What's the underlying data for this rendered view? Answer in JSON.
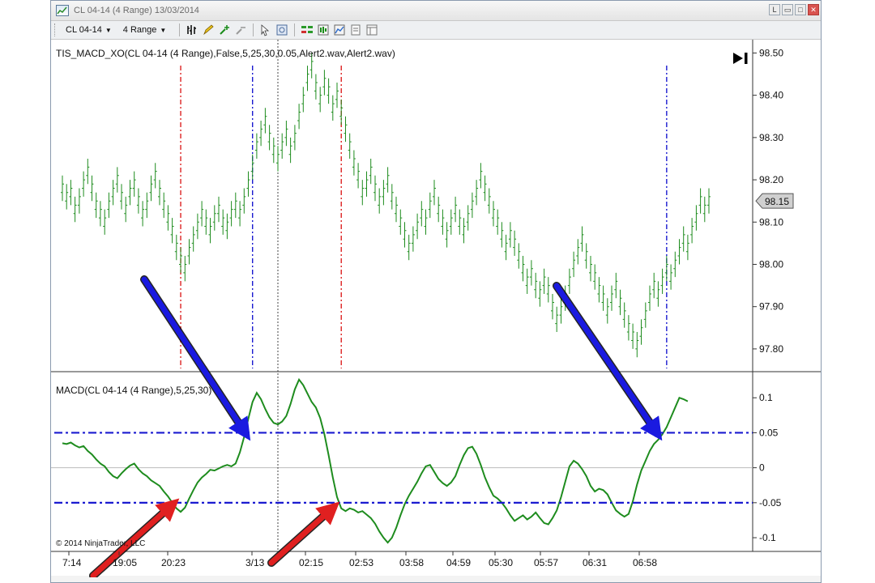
{
  "window": {
    "title": "CL 04-14 (4 Range)  13/03/2014",
    "controls": [
      "L",
      "▭",
      "□",
      "✕"
    ]
  },
  "toolbar": {
    "instrument": "CL 04-14",
    "interval": "4 Range"
  },
  "price_panel": {
    "indicator_label": "TIS_MACD_XO(CL 04-14 (4 Range),False,5,25,30,0.05,Alert2.wav,Alert2.wav)",
    "last_price": "98.15",
    "ticks": [
      "98.50",
      "98.40",
      "98.30",
      "98.20",
      "98.10",
      "98.00",
      "97.90",
      "97.80"
    ]
  },
  "macd_panel": {
    "indicator_label": "MACD(CL 04-14 (4 Range),5,25,30)",
    "ticks": [
      "0.1",
      "0.05",
      "0",
      "-0.05",
      "-0.1"
    ],
    "copyright": "© 2014 NinjaTrader, LLC"
  },
  "time_axis": {
    "ticks": [
      "7:14",
      "19:05",
      "20:23",
      "3/13",
      "02:15",
      "02:53",
      "03:58",
      "04:59",
      "05:30",
      "05:57",
      "06:31",
      "06:58"
    ]
  },
  "chart_data": {
    "type": "line",
    "price_series": {
      "ylim": [
        97.75,
        98.52
      ],
      "values": [
        98.18,
        98.16,
        98.17,
        98.13,
        98.15,
        98.19,
        98.22,
        98.18,
        98.14,
        98.12,
        98.1,
        98.14,
        98.17,
        98.2,
        98.16,
        98.13,
        98.17,
        98.19,
        98.15,
        98.12,
        98.14,
        98.18,
        98.21,
        98.17,
        98.14,
        98.11,
        98.08,
        98.04,
        98.01,
        97.99,
        98.03,
        98.06,
        98.09,
        98.12,
        98.1,
        98.08,
        98.11,
        98.13,
        98.1,
        98.09,
        98.12,
        98.14,
        98.12,
        98.15,
        98.19,
        98.23,
        98.28,
        98.31,
        98.34,
        98.3,
        98.27,
        98.25,
        98.28,
        98.31,
        98.27,
        98.3,
        98.35,
        98.39,
        98.44,
        98.47,
        98.42,
        98.39,
        98.43,
        98.41,
        98.37,
        98.4,
        98.36,
        98.32,
        98.28,
        98.24,
        98.21,
        98.17,
        98.19,
        98.22,
        98.18,
        98.15,
        98.17,
        98.2,
        98.16,
        98.13,
        98.1,
        98.07,
        98.04,
        98.06,
        98.09,
        98.12,
        98.1,
        98.14,
        98.17,
        98.13,
        98.1,
        98.07,
        98.1,
        98.13,
        98.1,
        98.08,
        98.11,
        98.14,
        98.17,
        98.21,
        98.18,
        98.15,
        98.12,
        98.1,
        98.07,
        98.04,
        98.07,
        98.05,
        98.02,
        97.99,
        97.96,
        97.98,
        97.95,
        97.93,
        97.96,
        97.94,
        97.9,
        97.87,
        97.89,
        97.92,
        97.96,
        98.0,
        98.03,
        98.06,
        98.02,
        97.99,
        97.97,
        97.94,
        97.92,
        97.89,
        97.92,
        97.95,
        97.91,
        97.88,
        97.85,
        97.83,
        97.81,
        97.84,
        97.88,
        97.92,
        97.95,
        97.93,
        97.96,
        97.99,
        97.97,
        98.0,
        98.03,
        98.06,
        98.04,
        98.08,
        98.11,
        98.15,
        98.13,
        98.15
      ]
    },
    "macd_series": {
      "ylim": [
        -0.115,
        0.135
      ],
      "values": [
        0.035,
        0.034,
        0.036,
        0.032,
        0.029,
        0.031,
        0.024,
        0.019,
        0.012,
        0.006,
        0.002,
        -0.006,
        -0.012,
        -0.015,
        -0.008,
        -0.002,
        0.003,
        0.006,
        -0.002,
        -0.008,
        -0.012,
        -0.018,
        -0.022,
        -0.026,
        -0.034,
        -0.041,
        -0.05,
        -0.058,
        -0.063,
        -0.057,
        -0.044,
        -0.032,
        -0.021,
        -0.014,
        -0.009,
        -0.003,
        -0.004,
        -0.001,
        0.002,
        0.004,
        0.002,
        0.006,
        0.022,
        0.044,
        0.07,
        0.094,
        0.107,
        0.098,
        0.084,
        0.072,
        0.064,
        0.062,
        0.066,
        0.074,
        0.091,
        0.112,
        0.126,
        0.118,
        0.106,
        0.094,
        0.086,
        0.071,
        0.048,
        0.018,
        -0.014,
        -0.042,
        -0.058,
        -0.062,
        -0.058,
        -0.06,
        -0.064,
        -0.062,
        -0.067,
        -0.072,
        -0.08,
        -0.091,
        -0.1,
        -0.107,
        -0.1,
        -0.086,
        -0.068,
        -0.052,
        -0.04,
        -0.03,
        -0.02,
        -0.008,
        0.002,
        0.004,
        -0.006,
        -0.016,
        -0.022,
        -0.026,
        -0.021,
        -0.012,
        0.004,
        0.018,
        0.028,
        0.03,
        0.02,
        0.004,
        -0.014,
        -0.028,
        -0.04,
        -0.044,
        -0.05,
        -0.058,
        -0.068,
        -0.076,
        -0.072,
        -0.068,
        -0.074,
        -0.07,
        -0.064,
        -0.072,
        -0.079,
        -0.081,
        -0.072,
        -0.061,
        -0.042,
        -0.02,
        0.002,
        0.01,
        0.006,
        -0.002,
        -0.012,
        -0.026,
        -0.034,
        -0.03,
        -0.032,
        -0.038,
        -0.05,
        -0.061,
        -0.066,
        -0.07,
        -0.066,
        -0.048,
        -0.024,
        -0.004,
        0.01,
        0.024,
        0.034,
        0.04,
        0.048,
        0.058,
        0.072,
        0.086,
        0.1,
        0.098,
        0.095
      ]
    },
    "thresholds": [
      0.05,
      -0.05
    ],
    "signal_lines_x_index": [
      {
        "index": 28,
        "color": "#dd2222"
      },
      {
        "index": 45,
        "color": "#1a1ad0"
      },
      {
        "index": 66,
        "color": "#dd2222"
      },
      {
        "index": 143,
        "color": "#1a1ad0"
      }
    ],
    "cursor_index": 51,
    "colors": {
      "price": "#1e8c1e",
      "macd": "#1e8c1e",
      "threshold": "#1a1ad0",
      "red_signal": "#dd2222",
      "blue_signal": "#1a1ad0",
      "grid": "#bbbbbb"
    }
  }
}
